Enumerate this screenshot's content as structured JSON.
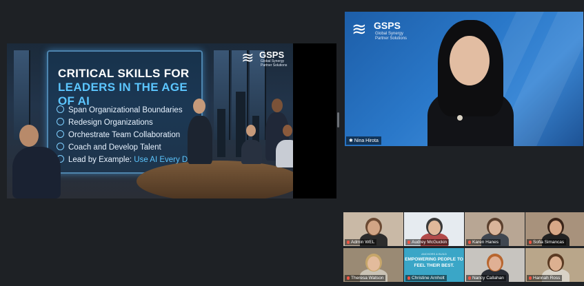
{
  "shared_screen": {
    "slide_title_line1": "CRITICAL SKILLS FOR",
    "slide_title_line2": "LEADERS IN THE AGE OF AI",
    "skills": [
      {
        "text": "Span Organizational Boundaries"
      },
      {
        "text": "Redesign Organizations"
      },
      {
        "text": "Orchestrate Team Collaboration"
      },
      {
        "text": "Coach and Develop Talent"
      }
    ],
    "last_skill_prefix": "Lead by Example:",
    "last_skill_highlight": "Use AI Every Day",
    "logo": {
      "name": "GSPS",
      "sub1": "Global Synergy",
      "sub2": "Partner Solutions"
    }
  },
  "speaker": {
    "name": "Nina Hirota",
    "logo": {
      "name": "GSPS",
      "sub1": "Global Synergy",
      "sub2": "Partner Solutions"
    }
  },
  "gallery": [
    {
      "name": "Admin WEL",
      "bg": "#c9b9a6",
      "face": "#d2a585",
      "shirt": "#2c2c2c",
      "hair": "#6b4a33"
    },
    {
      "name": "Audrey McGuckin",
      "bg": "#e6ebf0",
      "face": "#e0b89a",
      "shirt": "#b24a4a",
      "hair": "#3a3a3a"
    },
    {
      "name": "Karen Hanes",
      "bg": "#b8a694",
      "face": "#d9b49a",
      "shirt": "#3f4650",
      "hair": "#5a3f2d"
    },
    {
      "name": "Sofia Simancas",
      "bg": "#a8927c",
      "face": "#d8a887",
      "shirt": "#222",
      "hair": "#3a2418"
    },
    {
      "name": "Theresa Watson",
      "bg": "#9a8a74",
      "face": "#e3bb9c",
      "shirt": "#c9c2b4",
      "hair": "#c6a66a"
    },
    {
      "name": "Christine Arnholt",
      "bg": "#3aa6c7",
      "banner_small": "ANCHORS & BUILD",
      "banner_line1": "EMPOWERING PEOPLE TO",
      "banner_line2": "FEEL THEIR BEST."
    },
    {
      "name": "Nancy Callahan",
      "bg": "#c7c4bf",
      "face": "#e0b094",
      "shirt": "#2b2e36",
      "hair": "#b8662f"
    },
    {
      "name": "Hannah Ross",
      "bg": "#b9a68a",
      "face": "#dcb090",
      "shirt": "#d8d2c6",
      "hair": "#5a3a22"
    }
  ]
}
